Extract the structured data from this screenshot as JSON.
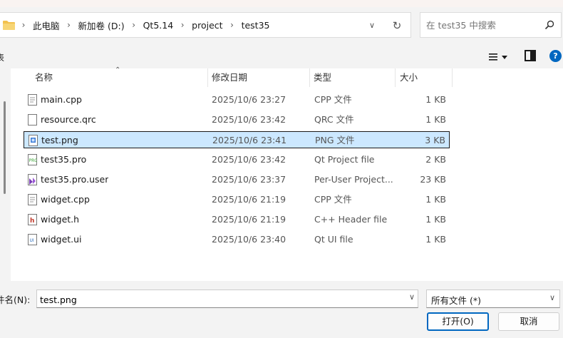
{
  "breadcrumbs": [
    "此电脑",
    "新加卷 (D:)",
    "Qt5.14",
    "project",
    "test35"
  ],
  "search": {
    "placeholder": "在 test35 中搜索"
  },
  "toolbar": {
    "left_label": "表"
  },
  "columns": {
    "name": "名称",
    "date": "修改日期",
    "type": "类型",
    "size": "大小"
  },
  "files": [
    {
      "name": "main.cpp",
      "date": "2025/10/6 23:27",
      "type": "CPP 文件",
      "size": "1 KB",
      "icon": "cpp-file-icon"
    },
    {
      "name": "resource.qrc",
      "date": "2025/10/6 23:42",
      "type": "QRC 文件",
      "size": "1 KB",
      "icon": "qrc-file-icon"
    },
    {
      "name": "test.png",
      "date": "2025/10/6 23:41",
      "type": "PNG 文件",
      "size": "3 KB",
      "icon": "png-file-icon",
      "selected": true
    },
    {
      "name": "test35.pro",
      "date": "2025/10/6 23:42",
      "type": "Qt Project file",
      "size": "2 KB",
      "icon": "pro-file-icon"
    },
    {
      "name": "test35.pro.user",
      "date": "2025/10/6 23:37",
      "type": "Per-User Project...",
      "size": "23 KB",
      "icon": "pro-user-file-icon"
    },
    {
      "name": "widget.cpp",
      "date": "2025/10/6 21:19",
      "type": "CPP 文件",
      "size": "1 KB",
      "icon": "cpp-file-icon"
    },
    {
      "name": "widget.h",
      "date": "2025/10/6 21:19",
      "type": "C++ Header file",
      "size": "1 KB",
      "icon": "header-file-icon"
    },
    {
      "name": "widget.ui",
      "date": "2025/10/6 23:40",
      "type": "Qt UI file",
      "size": "1 KB",
      "icon": "ui-file-icon"
    }
  ],
  "filename": {
    "label": "件名(N):",
    "value": "test.png"
  },
  "filetype": {
    "value": "所有文件 (*)"
  },
  "buttons": {
    "open": "打开(O)",
    "cancel": "取消"
  },
  "colors": {
    "accent": "#0067c0",
    "selection": "#cce8ff",
    "folder": "#f2c14e"
  }
}
